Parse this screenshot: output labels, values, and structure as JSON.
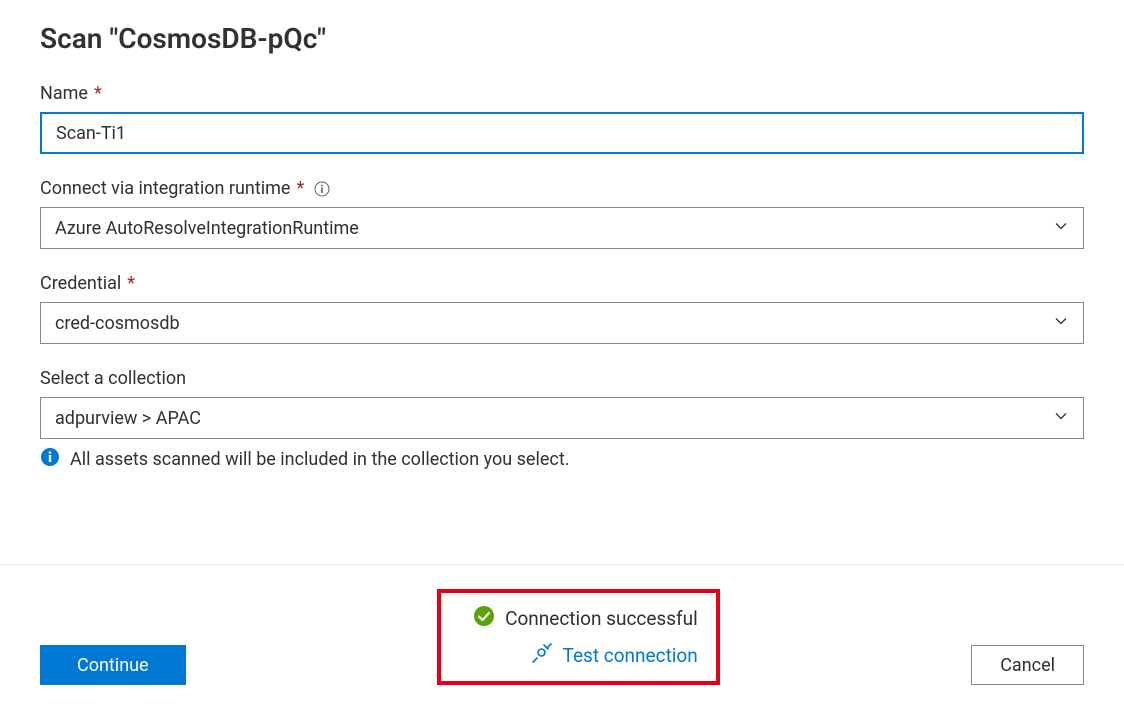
{
  "title": "Scan \"CosmosDB-pQc\"",
  "fields": {
    "name": {
      "label": "Name",
      "value": "Scan-Ti1"
    },
    "runtime": {
      "label": "Connect via integration runtime",
      "value": "Azure AutoResolveIntegrationRuntime"
    },
    "credential": {
      "label": "Credential",
      "value": "cred-cosmosdb"
    },
    "collection": {
      "label": "Select a collection",
      "value": "adpurview > APAC",
      "helper": "All assets scanned will be included in the collection you select."
    }
  },
  "footer": {
    "continue": "Continue",
    "cancel": "Cancel",
    "status": "Connection successful",
    "test": "Test connection"
  }
}
